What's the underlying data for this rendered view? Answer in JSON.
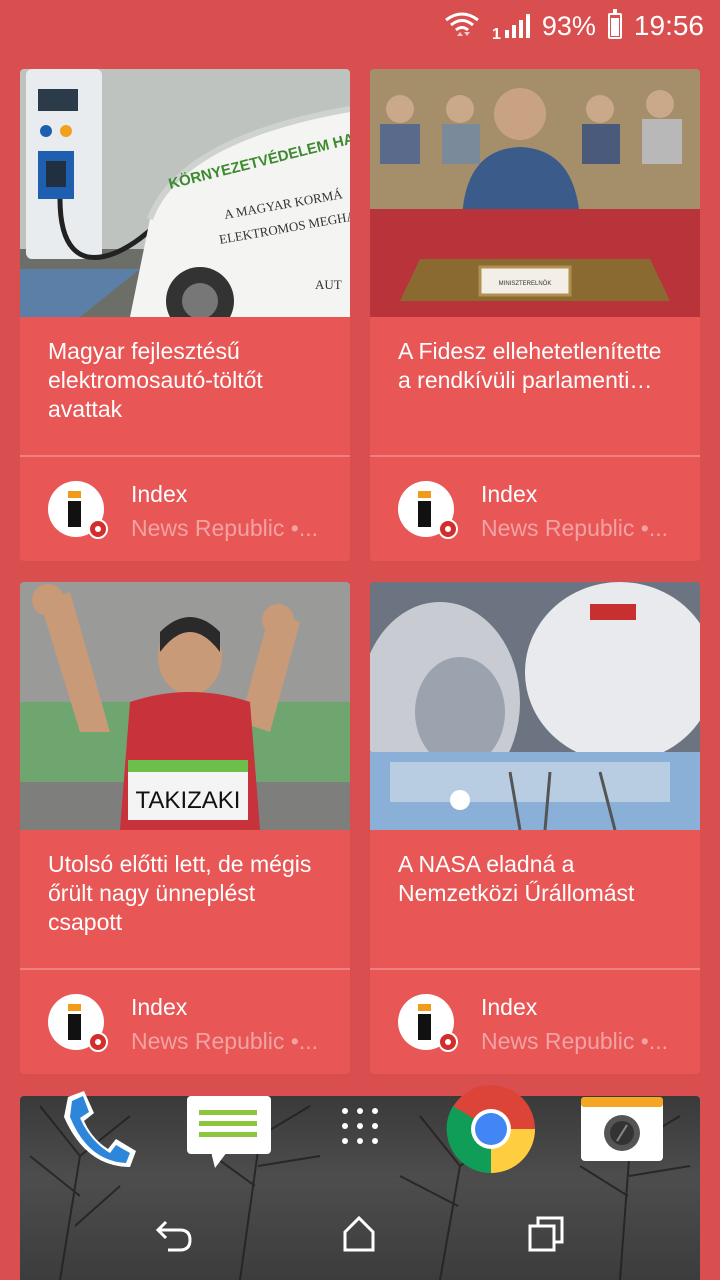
{
  "status_bar": {
    "battery": "93%",
    "time": "19:56",
    "signal_label": "1",
    "battery_level": 0.93
  },
  "cards": [
    {
      "title": "Magyar fejlesztésű elektromosautó-töltőt avattak",
      "source": "Index",
      "provider": "News Republic •..."
    },
    {
      "title": "A Fidesz ellehetetlenítette a rendkívüli parlamenti…",
      "source": "Index",
      "provider": "News Republic •..."
    },
    {
      "title": "Utolsó előtti lett, de mégis őrült nagy ünneplést csapott",
      "source": "Index",
      "provider": "News Republic •..."
    },
    {
      "title": "A NASA eladná a Nemzetközi Űrállomást",
      "source": "Index",
      "provider": "News Republic •..."
    }
  ],
  "image_text": {
    "car_lines": [
      "KÖRNYEZETVÉDELEM HAJTJA",
      "A MAGYAR KORMÁ",
      "ELEKTROMOS MEGHAJTÁ",
      "AUT"
    ],
    "bib": "TAKIZAKI",
    "nameplate": "MINISZTERELNÖK"
  },
  "dock": {
    "apps": [
      "phone-icon",
      "messages-icon",
      "app-drawer-icon",
      "chrome-icon",
      "camera-icon"
    ]
  },
  "nav": [
    "back-icon",
    "home-icon",
    "recents-icon"
  ]
}
